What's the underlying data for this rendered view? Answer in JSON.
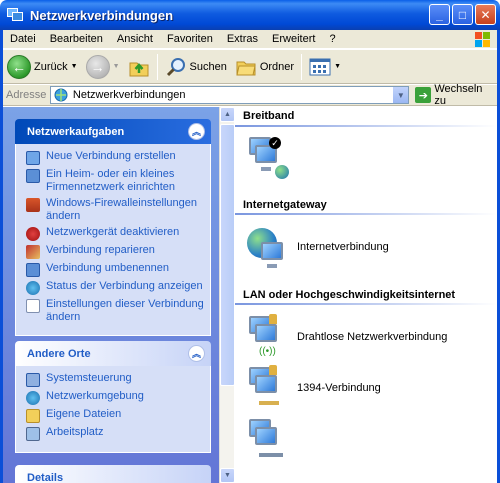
{
  "window": {
    "title": "Netzwerkverbindungen"
  },
  "menu": [
    "Datei",
    "Bearbeiten",
    "Ansicht",
    "Favoriten",
    "Extras",
    "Erweitert",
    "?"
  ],
  "toolbar": {
    "back_label": "Zurück",
    "search_label": "Suchen",
    "folders_label": "Ordner"
  },
  "address": {
    "label": "Adresse",
    "value": "Netzwerkverbindungen",
    "go_label": "Wechseln zu"
  },
  "tasks_panel": {
    "title": "Netzwerkaufgaben",
    "items": [
      "Neue Verbindung erstellen",
      "Ein Heim- oder ein kleines Firmennetzwerk einrichten",
      "Windows-Firewalleinstellungen ändern",
      "Netzwerkgerät deaktivieren",
      "Verbindung reparieren",
      "Verbindung umbenennen",
      "Status der Verbindung anzeigen",
      "Einstellungen dieser Verbindung ändern"
    ]
  },
  "places_panel": {
    "title": "Andere Orte",
    "items": [
      "Systemsteuerung",
      "Netzwerkumgebung",
      "Eigene Dateien",
      "Arbeitsplatz"
    ]
  },
  "details_panel": {
    "title": "Details"
  },
  "groups": {
    "broadband": "Breitband",
    "gateway": "Internetgateway",
    "gateway_item": "Internetverbindung",
    "lan": "LAN oder Hochgeschwindigkeitsinternet",
    "lan_items": [
      "Drahtlose Netzwerkverbindung",
      "1394-Verbindung",
      ""
    ]
  }
}
